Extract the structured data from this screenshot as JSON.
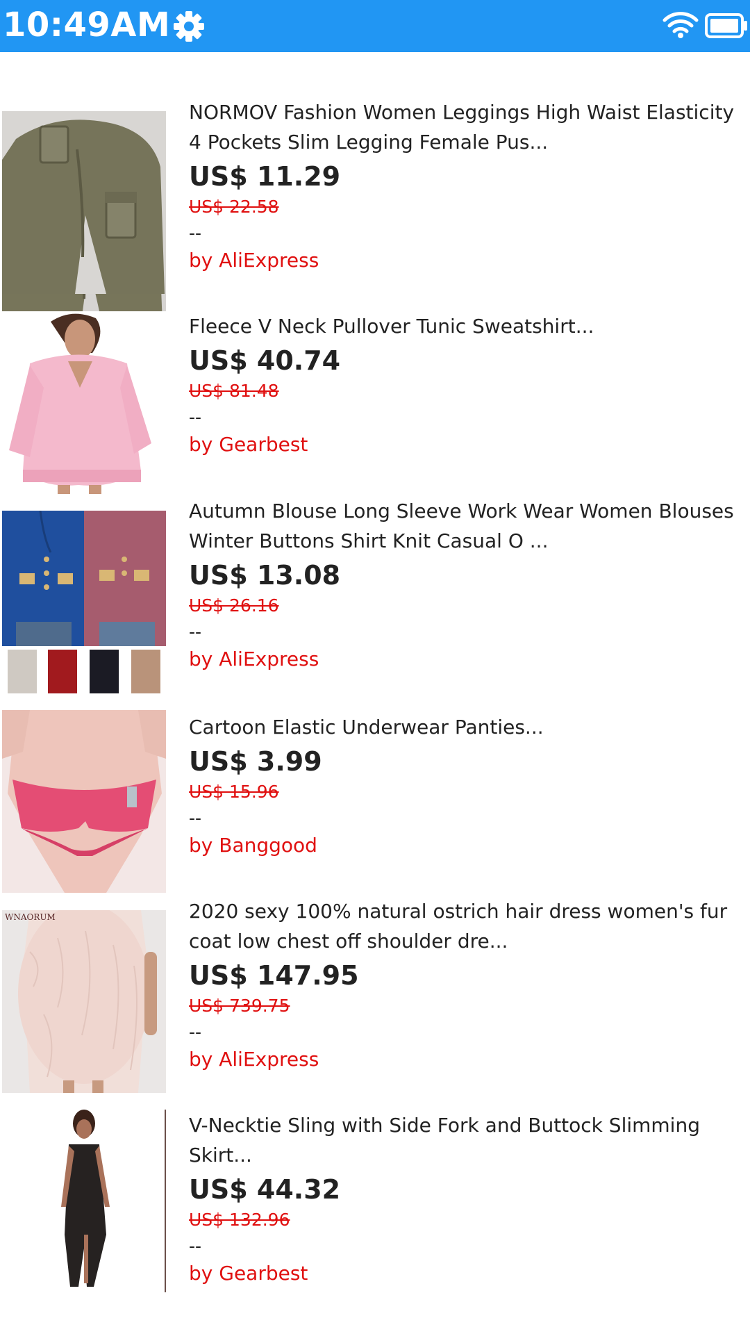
{
  "status_bar": {
    "time": "10:49AM",
    "color": "#2196F3",
    "icons": [
      "gear-icon",
      "wifi-icon",
      "battery-icon"
    ]
  },
  "products": [
    {
      "title": "NORMOV Fashion Women Leggings High Waist Elasticity 4 Pockets Slim Legging Female Pus...",
      "price": "US$ 11.29",
      "original_price": "US$ 22.58",
      "rating": "--",
      "seller": "by AliExpress"
    },
    {
      "title": "Fleece V Neck Pullover Tunic Sweatshirt...",
      "price": "US$ 40.74",
      "original_price": "US$ 81.48",
      "rating": "--",
      "seller": "by Gearbest"
    },
    {
      "title": "Autumn Blouse Long Sleeve Work Wear Women Blouses Winter Buttons Shirt Knit Casual O ...",
      "price": "US$ 13.08",
      "original_price": "US$ 26.16",
      "rating": "--",
      "seller": "by AliExpress"
    },
    {
      "title": "Cartoon Elastic Underwear Panties...",
      "price": "US$ 3.99",
      "original_price": "US$ 15.96",
      "rating": "--",
      "seller": "by Banggood"
    },
    {
      "title": "2020 sexy 100% natural ostrich hair dress women's fur coat low chest off shoulder dre...",
      "price": "US$ 147.95",
      "original_price": "US$ 739.75",
      "rating": "--",
      "seller": "by AliExpress",
      "image_watermark": "WNAORUM"
    },
    {
      "title": "V-Necktie Sling with Side Fork and Buttock Slimming Skirt...",
      "price": "US$ 44.32",
      "original_price": "US$ 132.96",
      "rating": "--",
      "seller": "by Gearbest"
    }
  ]
}
